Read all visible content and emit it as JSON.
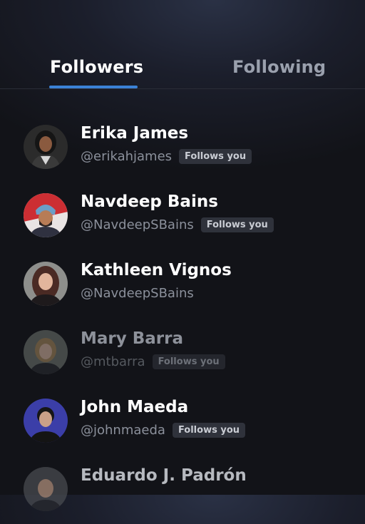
{
  "tabs": {
    "followers": "Followers",
    "following": "Following",
    "active": "Followers"
  },
  "users": [
    {
      "name": "Erika James",
      "handle": "@erikahjames",
      "badge": "Follows you"
    },
    {
      "name": "Navdeep Bains",
      "handle": "@NavdeepSBains",
      "badge": "Follows you"
    },
    {
      "name": "Kathleen Vignos",
      "handle": "@NavdeepSBains",
      "badge": ""
    },
    {
      "name": "Mary Barra",
      "handle": "@mtbarra",
      "badge": "Follows you"
    },
    {
      "name": "John Maeda",
      "handle": "@johnmaeda",
      "badge": "Follows you"
    },
    {
      "name": "Eduardo J. Padrón",
      "handle": "",
      "badge": ""
    }
  ],
  "colors": {
    "accent": "#3b82d6",
    "background": "#15161c",
    "badge_bg": "#2f323b"
  }
}
